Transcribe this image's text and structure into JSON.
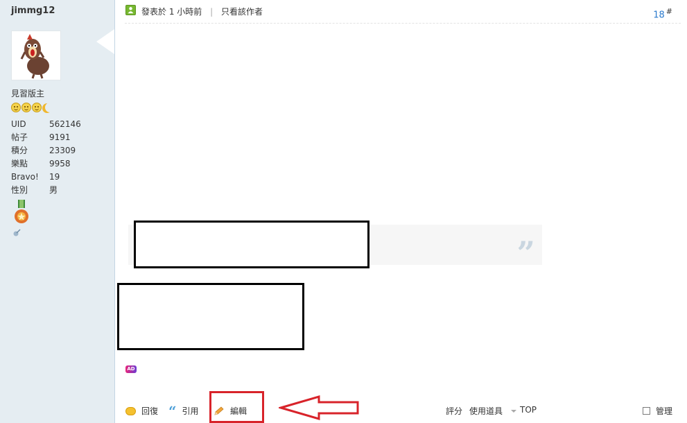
{
  "user": {
    "username": "jimmg12",
    "rank": "見習版主",
    "stats": [
      {
        "key": "UID",
        "value": "562146"
      },
      {
        "key": "帖子",
        "value": "9191"
      },
      {
        "key": "積分",
        "value": "23309"
      },
      {
        "key": "樂點",
        "value": "9958"
      },
      {
        "key": "Bravo!",
        "value": "19"
      },
      {
        "key": "性別",
        "value": "男"
      }
    ]
  },
  "post": {
    "posted_label": "發表於",
    "time": "1 小時前",
    "author_only": "只看該作者",
    "floor": "18",
    "floor_mark": "#"
  },
  "content": {
    "quote_mark": "”",
    "ad_badge": "AD"
  },
  "actions": {
    "reply": "回復",
    "quote": "引用",
    "edit": "編輯",
    "rate": "評分",
    "use_tool": "使用道具",
    "top": "TOP",
    "manage": "管理"
  },
  "colors": {
    "sidebar_bg": "#e5edf2",
    "link_blue": "#2b7acd",
    "annotation_red": "#d8232a"
  }
}
